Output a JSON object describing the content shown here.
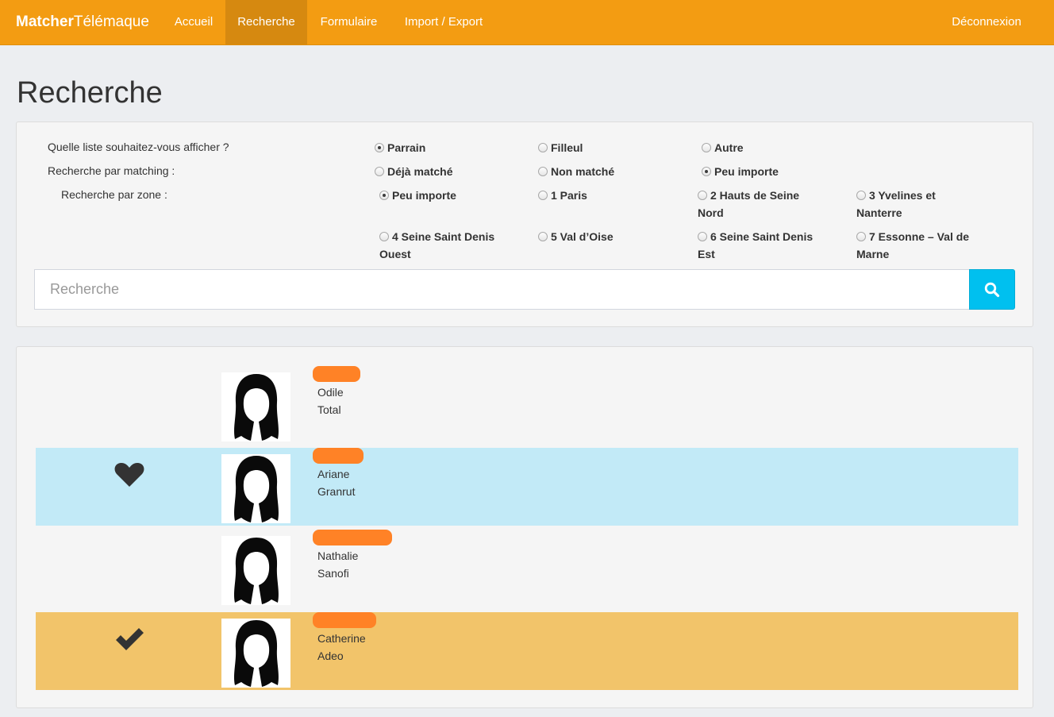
{
  "nav": {
    "brand_bold": "Matcher",
    "brand_light": "Télémaque",
    "items": [
      {
        "label": "Accueil",
        "active": false
      },
      {
        "label": "Recherche",
        "active": true
      },
      {
        "label": "Formulaire",
        "active": false
      },
      {
        "label": "Import / Export",
        "active": false
      }
    ],
    "logout": "Déconnexion"
  },
  "page": {
    "title": "Recherche"
  },
  "filters": {
    "list_question": "Quelle liste souhaitez-vous afficher ?",
    "list_options": [
      {
        "label": "Parrain",
        "checked": true
      },
      {
        "label": "Filleul",
        "checked": false
      },
      {
        "label": "Autre",
        "checked": false
      }
    ],
    "matching_question": "Recherche par matching :",
    "matching_options": [
      {
        "label": "Déjà matché",
        "checked": false
      },
      {
        "label": "Non matché",
        "checked": false
      },
      {
        "label": "Peu importe",
        "checked": true
      }
    ],
    "zone_question": "Recherche par zone :",
    "zone_options": [
      {
        "label": "Peu importe",
        "checked": true
      },
      {
        "label": "1 Paris",
        "checked": false
      },
      {
        "label": "2 Hauts de Seine Nord",
        "checked": false
      },
      {
        "label": "3 Yvelines et Nanterre",
        "checked": false
      },
      {
        "label": "4 Seine Saint Denis Ouest",
        "checked": false
      },
      {
        "label": "5 Val d’Oise",
        "checked": false
      },
      {
        "label": "6 Seine Saint Denis Est",
        "checked": false
      },
      {
        "label": "7 Essonne – Val de Marne",
        "checked": false
      }
    ]
  },
  "search": {
    "placeholder": "Recherche",
    "value": "",
    "button_icon": "search-icon"
  },
  "results": [
    {
      "first_name": "Odile",
      "company": "Total",
      "status_icon": "",
      "highlight": "none",
      "accent_color": "#ff8226"
    },
    {
      "first_name": "Ariane",
      "company": "Granrut",
      "status_icon": "heart-icon",
      "highlight": "blue",
      "highlight_color": "#c2eaf7"
    },
    {
      "first_name": "Nathalie",
      "company": "Sanofi",
      "status_icon": "",
      "highlight": "none"
    },
    {
      "first_name": "Catherine",
      "company": "Adeo",
      "status_icon": "check-icon",
      "highlight": "gold",
      "highlight_color": "#f2c46a"
    }
  ],
  "colors": {
    "navbar": "#f39c12",
    "navbar_active": "#d68910",
    "search_button": "#00c0ef"
  }
}
